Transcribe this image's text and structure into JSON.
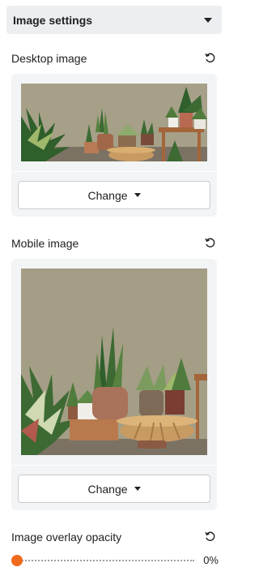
{
  "header": {
    "title": "Image settings",
    "collapse_icon": "caret-down-icon"
  },
  "desktop": {
    "label": "Desktop image",
    "reset_icon": "reset-icon",
    "change_label": "Change",
    "dropdown_icon": "caret-down-icon"
  },
  "mobile": {
    "label": "Mobile image",
    "reset_icon": "reset-icon",
    "change_label": "Change",
    "dropdown_icon": "caret-down-icon"
  },
  "overlay": {
    "label": "Image overlay opacity",
    "reset_icon": "reset-icon",
    "value": 0,
    "value_text": "0%"
  },
  "colors": {
    "accent": "#f06a1d",
    "panel": "#eceef1",
    "card": "#f3f4f5"
  }
}
